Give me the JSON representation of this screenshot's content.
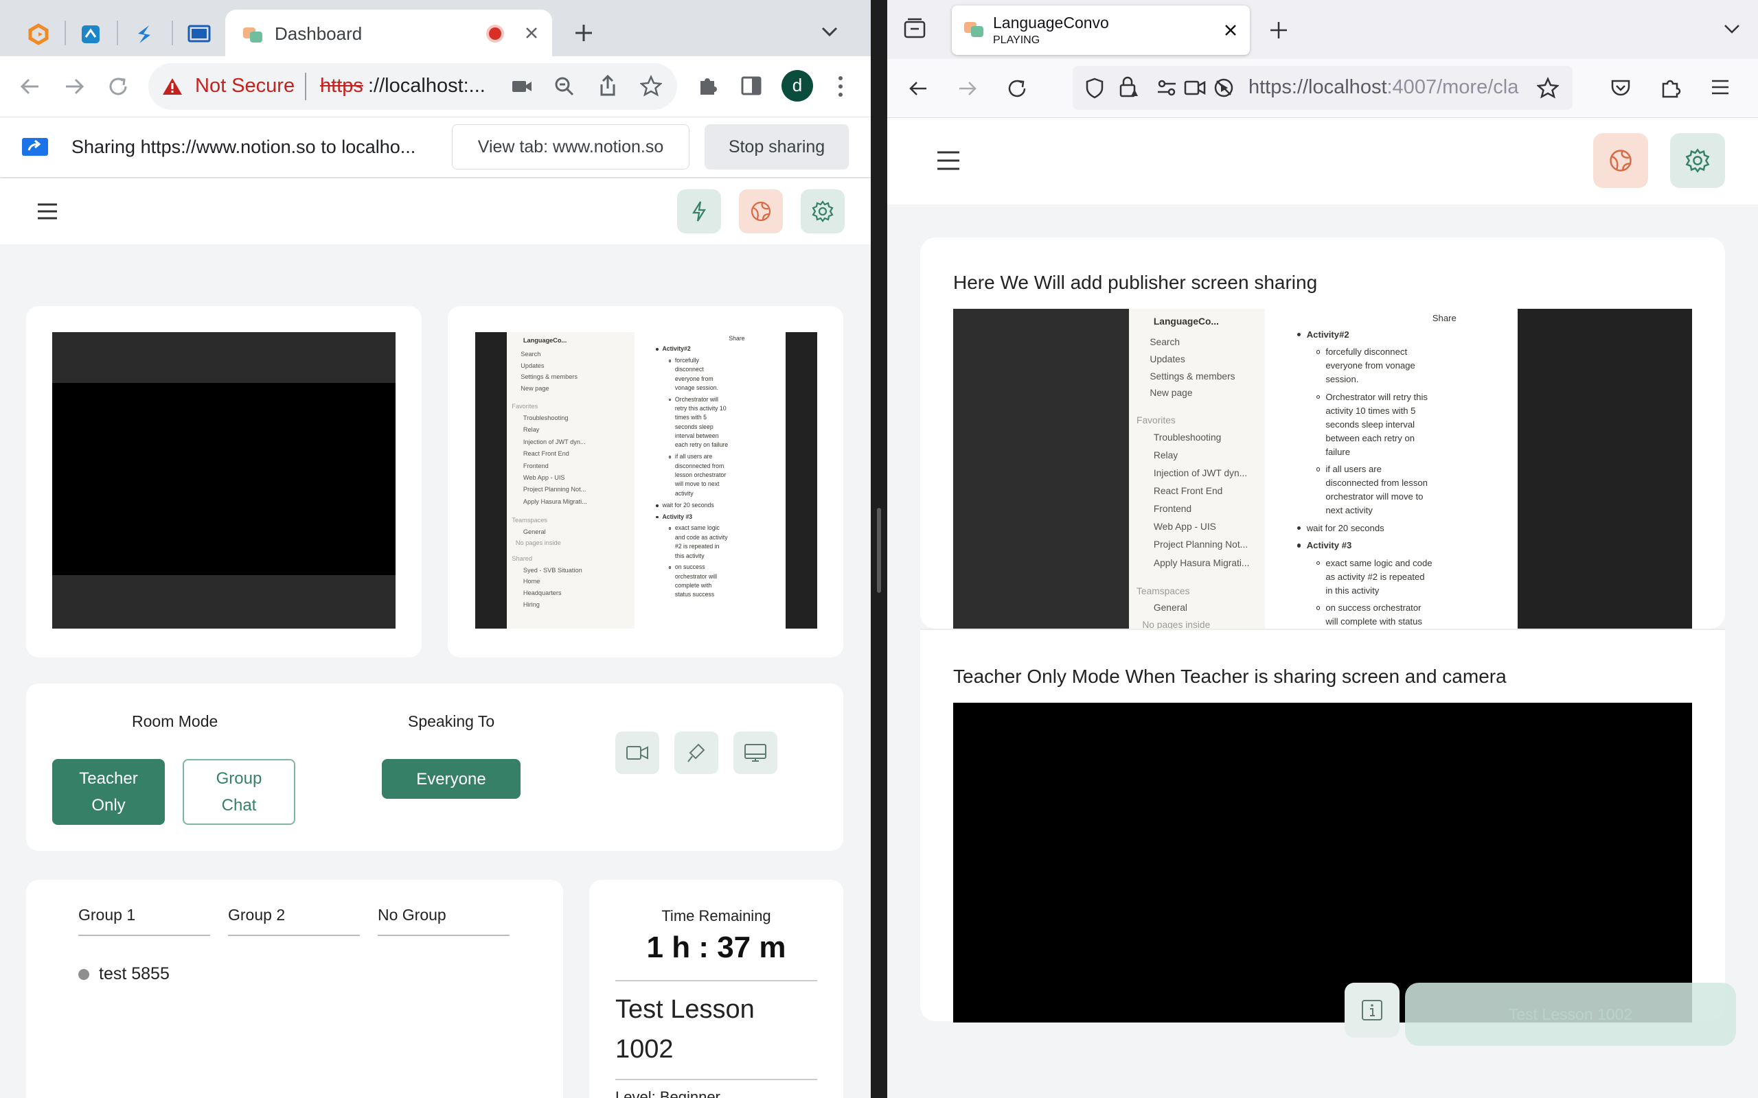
{
  "left_browser": {
    "pinned_tabs": [
      "app-logo-orange-icon",
      "blue-doc-icon",
      "blue-s-logo-icon",
      "screen-icon"
    ],
    "active_tab": {
      "title": "Dashboard",
      "recording": true
    },
    "address": {
      "warning": "Not Secure",
      "scheme": "https",
      "rest": "://localhost:..."
    },
    "profile_initial": "d",
    "sharing_bar": {
      "message": "Sharing https://www.notion.so to localho...",
      "view_tab_label": "View tab: www.notion.so",
      "stop_label": "Stop sharing"
    }
  },
  "dashboard": {
    "room_mode": {
      "label": "Room Mode",
      "options": [
        "Teacher Only",
        "Group Chat"
      ],
      "selected": "Teacher Only"
    },
    "speaking_to": {
      "label": "Speaking To",
      "value": "Everyone"
    },
    "groups": {
      "tabs": [
        "Group 1",
        "Group 2",
        "No Group"
      ],
      "members": [
        {
          "name": "test 5855",
          "status": "offline"
        }
      ]
    },
    "time_remaining": {
      "label": "Time Remaining",
      "value": "1 h : 37 m"
    },
    "lesson": {
      "title": "Test Lesson 1002",
      "level_partial": "Level: Beginner"
    }
  },
  "notion_preview": {
    "workspace": "LanguageCo...",
    "sidebar_top": [
      "Search",
      "Updates",
      "Settings & members",
      "New page"
    ],
    "favorites_label": "Favorites",
    "favorites": [
      "Troubleshooting",
      "Relay",
      "Injection of JWT dyn...",
      "React Front End",
      "Frontend",
      "Web App - UIS",
      "Project Planning Not...",
      "Apply Hasura Migrati..."
    ],
    "teamspaces_label": "Teamspaces",
    "teamspaces": [
      "General"
    ],
    "no_pages": "No pages inside",
    "shared_label": "Shared",
    "shared": [
      "Syed - SVB Situation",
      "Home",
      "Headquarters",
      "Hiring"
    ],
    "share_label": "Share",
    "content": [
      {
        "level": 1,
        "text": "Activity#2",
        "bold": true
      },
      {
        "level": 2,
        "text": "forcefully disconnect everyone from vonage session."
      },
      {
        "level": 2,
        "text": "Orchestrator will retry this activity 10 times with 5 seconds sleep interval between each retry on failure"
      },
      {
        "level": 2,
        "text": "if all users are disconnected from lesson orchestrator will move to next activity"
      },
      {
        "level": 1,
        "text": "wait for 20 seconds"
      },
      {
        "level": 1,
        "text": "Activity #3",
        "bold": true
      },
      {
        "level": 2,
        "text": "exact same logic and code as activity #2 is repeated in this activity"
      },
      {
        "level": 2,
        "text": "on success orchestrator will complete with status success"
      }
    ]
  },
  "right_browser": {
    "tab_title": "LanguageConvo",
    "tab_status": "PLAYING",
    "url_host": "https://localhost",
    "url_rest": ":4007/more/cla",
    "sections": [
      {
        "heading": "Here We Will add publisher screen sharing"
      },
      {
        "heading": "Teacher Only Mode When Teacher is sharing screen and camera"
      }
    ],
    "floating_label": "Test Lesson 1002"
  },
  "colors": {
    "primary": "#368067",
    "accent_orange_bg": "#f9e0d6",
    "accent_green_bg": "#dfebe7",
    "not_secure": "#c5221f"
  }
}
